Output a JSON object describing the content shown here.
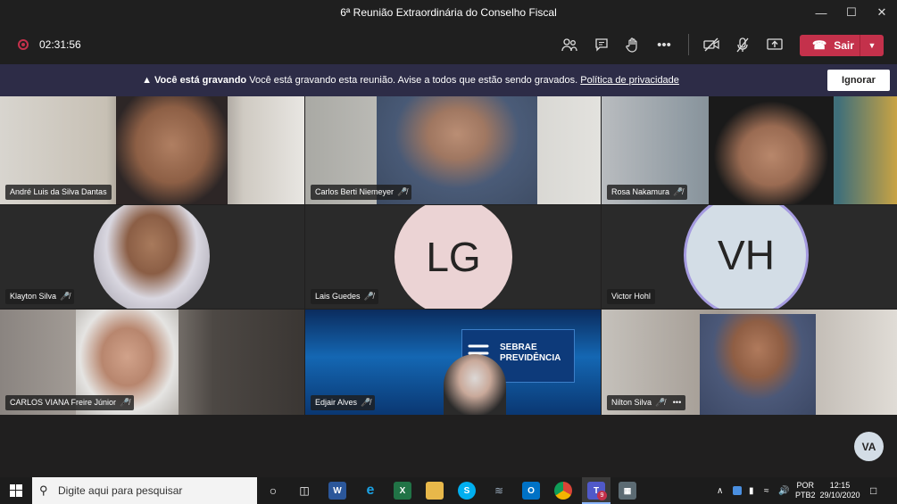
{
  "window": {
    "title": "6ª Reunião Extraordinária do Conselho Fiscal"
  },
  "toolbar": {
    "timer": "02:31:56",
    "leave_label": "Sair"
  },
  "banner": {
    "bold": "Você está gravando",
    "message": "Você está gravando esta reunião. Avise a todos que estão sendo gravados.",
    "privacy_link": "Política de privacidade",
    "ignore_label": "Ignorar"
  },
  "participants": [
    {
      "name": "André Luis da Silva Dantas",
      "muted": false
    },
    {
      "name": "Carlos Berti Niemeyer",
      "muted": true
    },
    {
      "name": "Rosa Nakamura",
      "muted": true
    },
    {
      "name": "Klayton Silva",
      "muted": true
    },
    {
      "name": "Lais Guedes",
      "muted": true,
      "initials": "LG"
    },
    {
      "name": "Victor Hohl",
      "muted": false,
      "initials": "VH",
      "speaking": true
    },
    {
      "name": "CARLOS VIANA Freire Júnior",
      "muted": true
    },
    {
      "name": "Edjair Alves",
      "muted": true,
      "background_text": [
        "SEBRAE",
        "PREVIDÊNCIA"
      ]
    },
    {
      "name": "Nilton Silva",
      "muted": true,
      "more": "•••"
    }
  ],
  "self_avatar": "VA",
  "taskbar": {
    "search_placeholder": "Digite aqui para pesquisar",
    "teams_badge": "9",
    "language": "POR",
    "keyboard": "PTB2",
    "time": "12:15",
    "date": "29/10/2020"
  },
  "colors": {
    "leave_red": "#c4314b",
    "banner_bg": "#2d2c47",
    "speaking_ring": "#a59be0"
  }
}
